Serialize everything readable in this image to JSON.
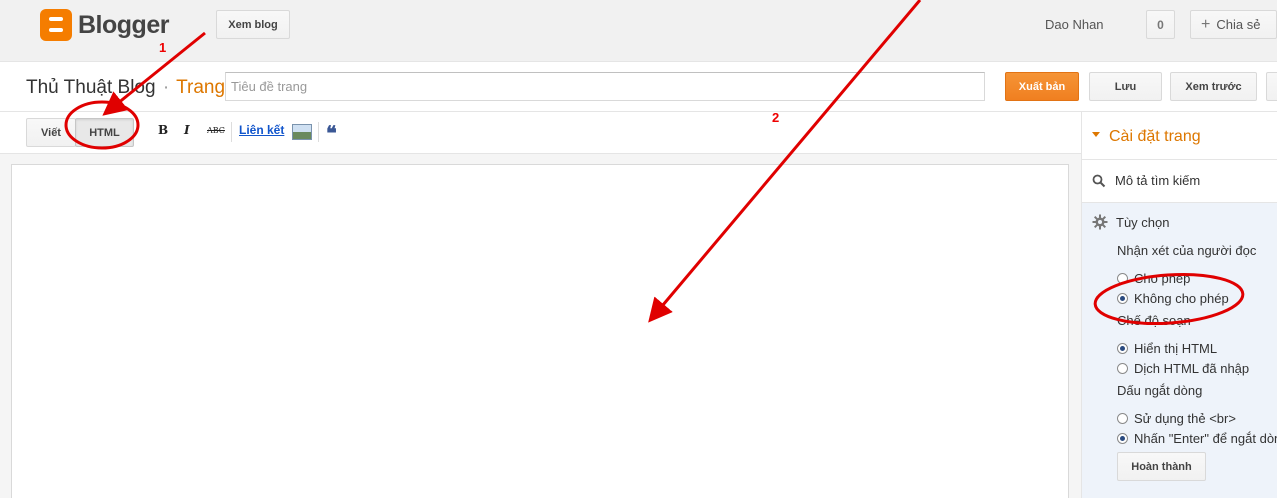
{
  "header": {
    "brand": "Blogger",
    "view_blog": "Xem blog",
    "user_name": "Dao Nhan",
    "share_count": "0",
    "share_label": "Chia sẻ"
  },
  "titlebar": {
    "blog_name": "Thủ Thuật Blog",
    "separator": "·",
    "section": "Trang",
    "title_placeholder": "Tiêu đề trang",
    "title_value": "",
    "publish": "Xuất bản",
    "save": "Lưu",
    "preview": "Xem trước"
  },
  "toolbar": {
    "compose": "Viết",
    "html": "HTML",
    "bold": "B",
    "italic": "I",
    "strike": "ABC",
    "link": "Liên kết",
    "quote": "❝"
  },
  "sidebar": {
    "heading": "Cài đặt trang",
    "search_desc": "Mô tả tìm kiếm",
    "options_title": "Tùy chọn",
    "comments_label": "Nhận xét của người đọc",
    "comments_allow": "Cho phép",
    "comments_deny": "Không cho phép",
    "compose_mode_label": "Chế độ soạn",
    "mode_show_html": "Hiển thị HTML",
    "mode_interpret_html": "Dịch HTML đã nhập",
    "line_break_label": "Dấu ngắt dòng",
    "br_tag": "Sử dụng thẻ <br>",
    "enter_break": "Nhấn \"Enter\" để ngắt dòng",
    "done": "Hoàn thành"
  },
  "selected": {
    "comments": "deny",
    "compose_mode": "show_html",
    "line_break": "enter"
  },
  "annotations": {
    "step1": "1",
    "step2": "2"
  },
  "colors": {
    "brand_orange": "#f57d00",
    "accent_orange": "#dd7700",
    "annotation_red": "#e00000",
    "options_bg": "#eef3fa"
  }
}
